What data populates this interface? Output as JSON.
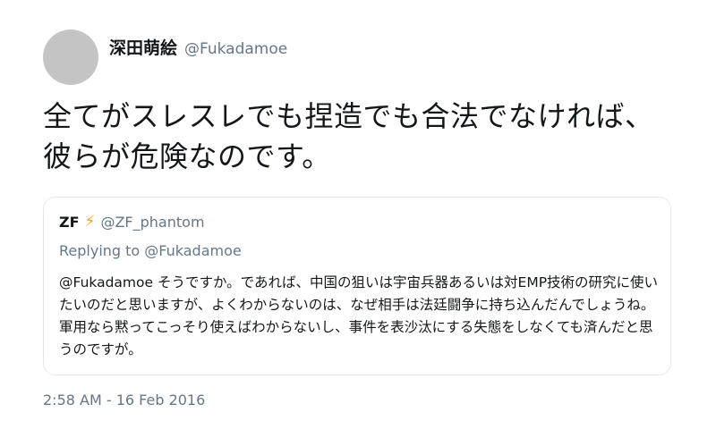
{
  "tweet": {
    "author": {
      "display_name": "深田萌絵",
      "handle": "@Fukadamoe"
    },
    "text": "全てがスレスレでも捏造でも合法でなければ、彼らが危険なのです。",
    "timestamp": "2:58 AM - 16 Feb 2016"
  },
  "quoted_tweet": {
    "author": {
      "name": "ZF",
      "icon": "lightning-bolt-icon",
      "handle": "@ZF_phantom"
    },
    "replying_prefix": "Replying to ",
    "replying_to": "@Fukadamoe",
    "mention": "@Fukadamoe",
    "body": " そうですか。であれば、中国の狙いは宇宙兵器あるいは対EMP技術の研究に使いたいのだと思いますが、よくわからないのは、なぜ相手は法廷闘争に持ち込んだんでしょうね。軍用なら黙ってこっそり使えばわからないし、事件を表沙汰にする失態をしなくても済んだと思うのですが。"
  },
  "colors": {
    "primary_text": "#14171a",
    "secondary_text": "#657786",
    "border": "#e1e8ed",
    "avatar_placeholder": "#c4c4c4",
    "bolt": "#f5a623"
  }
}
